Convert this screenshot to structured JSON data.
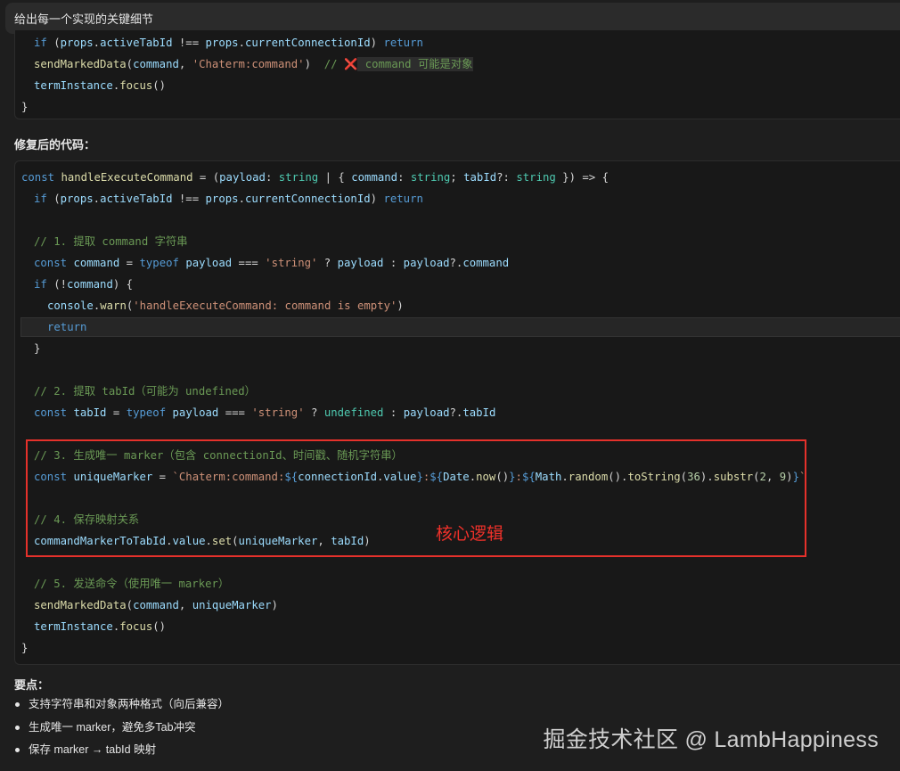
{
  "top_bar": {
    "text": "给出每一个实现的关键细节"
  },
  "code_snippet_1": [
    "if (props.activeTabId !== props.currentConnectionId) return",
    "sendMarkedData(command, 'Chaterm:command')  // ❌ command 可能是对象",
    "termInstance.focus()",
    "}"
  ],
  "fixed_code_heading": "修复后的代码：",
  "code_snippet_2": [
    "const handleExecuteCommand = (payload: string | { command: string; tabId?: string }) => {",
    "if (props.activeTabId !== props.currentConnectionId) return",
    "",
    "// 1. 提取 command 字符串",
    "const command = typeof payload === 'string' ? payload : payload?.command",
    "if (!command) {",
    "console.warn('handleExecuteCommand: command is empty')",
    "return",
    "}",
    "",
    "// 2. 提取 tabId（可能为 undefined）",
    "const tabId = typeof payload === 'string' ? undefined : payload?.tabId",
    "",
    "// 3. 生成唯一 marker（包含 connectionId、时间戳、随机字符串）",
    "const uniqueMarker = `Chaterm:command:${connectionId.value}:${Date.now()}:${Math.random().toString(36).substr(2, 9)}`",
    "",
    "// 4. 保存映射关系",
    "commandMarkerToTabId.value.set(uniqueMarker, tabId)",
    "",
    "// 5. 发送命令（使用唯一 marker）",
    "sendMarkedData(command, uniqueMarker)",
    "termInstance.focus()",
    "}"
  ],
  "annotation": "核心逻辑",
  "key_points_heading": "要点：",
  "key_points": [
    "支持字符串和对象两种格式（向后兼容）",
    "生成唯一 marker，避免多Tab冲突",
    "保存 marker → tabId 映射"
  ],
  "watermark": "掘金技术社区 @ LambHappiness"
}
